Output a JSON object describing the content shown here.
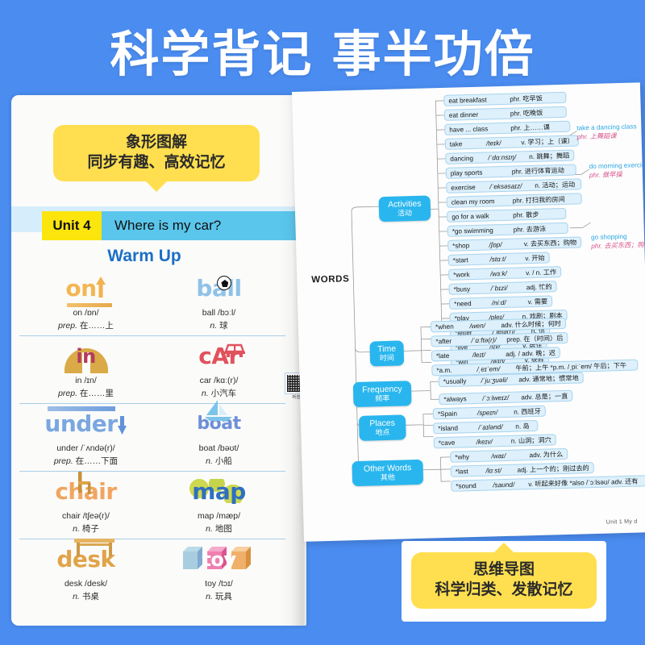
{
  "banner": {
    "title": "科学背记 事半功倍",
    "bg_color": "#4a8cf0",
    "text_color": "#ffffff"
  },
  "callout_top": {
    "line1": "象形图解",
    "line2": "同步有趣、高效记忆",
    "bg_color": "#ffdf4f"
  },
  "callout_bottom": {
    "line1": "思维导图",
    "line2": "科学归类、发散记忆",
    "bg_color": "#ffdf4f"
  },
  "left_page": {
    "unit_tag": "Unit 4",
    "unit_title": "Where is my car?",
    "section_title": "Warm Up",
    "qr": {
      "icon": "qr-code-icon",
      "label": "听音"
    },
    "column_left": [
      {
        "word": "on",
        "phonetic": "on /ɒn/",
        "pos": "prep.",
        "meaning": "在……上",
        "color": "#f4b651",
        "art": "arrow-up-icon"
      },
      {
        "word": "in",
        "phonetic": "in /ɪn/",
        "pos": "prep.",
        "meaning": "在……里",
        "color": "#b33a5e",
        "art": "dome-icon"
      },
      {
        "word": "under",
        "phonetic": "under /ˈʌndə(r)/",
        "pos": "prep.",
        "meaning": "在……下面",
        "color": "#7aa7e0",
        "art": "arrow-down-icon"
      },
      {
        "word": "chair",
        "phonetic": "chair /tʃeə(r)/",
        "pos": "n.",
        "meaning": "椅子",
        "color": "#f2a45f",
        "art": "chair-icon"
      },
      {
        "word": "desk",
        "phonetic": "desk /desk/",
        "pos": "n.",
        "meaning": "书桌",
        "color": "#e0a44a",
        "art": "desk-icon"
      }
    ],
    "column_right": [
      {
        "word": "ball",
        "phonetic": "ball /bɔːl/",
        "pos": "n.",
        "meaning": "球",
        "color": "#8fc2e8",
        "art": "soccer-ball-icon"
      },
      {
        "word": "cAr",
        "phonetic": "car /kɑː(r)/",
        "pos": "n.",
        "meaning": "小汽车",
        "color": "#e0525c",
        "art": "car-icon"
      },
      {
        "word": "boat",
        "phonetic": "boat /bəʊt/",
        "pos": "n.",
        "meaning": "小船",
        "color": "#6f8fd6",
        "art": "sailboat-icon"
      },
      {
        "word": "map",
        "phonetic": "map /mæp/",
        "pos": "n.",
        "meaning": "地图",
        "color": "#2f6fc0",
        "art": "map-blob-icon"
      },
      {
        "word": "toy",
        "phonetic": "toy /tɔɪ/",
        "pos": "n.",
        "meaning": "玩具",
        "color": "#ffffff",
        "art": "toy-blocks-icon"
      }
    ]
  },
  "right_page": {
    "root_label": "WORDS",
    "footer": "Unit 1   My d",
    "categories": [
      {
        "en": "Activities",
        "cn": "活动"
      },
      {
        "en": "Time",
        "cn": "时间"
      },
      {
        "en": "Frequency",
        "cn": "频率"
      },
      {
        "en": "Places",
        "cn": "地点"
      },
      {
        "en": "Other Words",
        "cn": "其他"
      }
    ],
    "activities": [
      {
        "word": "eat breakfast",
        "phon": "",
        "mean": "phr. 吃早饭"
      },
      {
        "word": "eat dinner",
        "phon": "",
        "mean": "phr. 吃晚饭"
      },
      {
        "word": "have ... class",
        "phon": "",
        "mean": "phr. 上……课"
      },
      {
        "word": "take",
        "phon": "/teɪk/",
        "mean": "v. 学习；上（课）"
      },
      {
        "word": "dancing",
        "phon": "/ˈdɑːnsɪŋ/",
        "mean": "n. 跳舞；舞蹈"
      },
      {
        "word": "play sports",
        "phon": "",
        "mean": "phr. 进行体育运动"
      },
      {
        "word": "exercise",
        "phon": "/ˈeksəsaɪz/",
        "mean": "n. 活动；运动"
      },
      {
        "word": "clean my room",
        "phon": "",
        "mean": "phr. 打扫我的房间"
      },
      {
        "word": "go for a walk",
        "phon": "",
        "mean": "phr. 散步"
      },
      {
        "word": "*go swimming",
        "phon": "",
        "mean": "phr. 去游泳"
      },
      {
        "word": "*shop",
        "phon": "/ʃɒp/",
        "mean": "v. 去买东西；购物"
      },
      {
        "word": "*start",
        "phon": "/stɑːt/",
        "mean": "v. 开始"
      },
      {
        "word": "*work",
        "phon": "/wɜːk/",
        "mean": "v. / n. 工作"
      },
      {
        "word": "*busy",
        "phon": "/ˈbɪzi/",
        "mean": "adj. 忙的"
      },
      {
        "word": "*need",
        "phon": "/niːd/",
        "mean": "v. 需要"
      },
      {
        "word": "*play",
        "phon": "/pleɪ/",
        "mean": "n. 戏剧；剧本"
      },
      {
        "word": "*letter",
        "phon": "/ˈletə(r)/",
        "mean": "n. 信"
      },
      {
        "word": "*live",
        "phon": "/lɪv/",
        "mean": "v. 居住"
      },
      {
        "word": "*win",
        "phon": "/wɪn/",
        "mean": "v. 获胜"
      }
    ],
    "time": [
      {
        "word": "*when",
        "phon": "/wen/",
        "mean": "adv. 什么时候；何时"
      },
      {
        "word": "*after",
        "phon": "/ˈɑːftə(r)/",
        "mean": "prep. 在（时间）后"
      },
      {
        "word": "*late",
        "phon": "/leɪt/",
        "mean": "adj. / adv. 晚；迟"
      },
      {
        "word": "*a.m.",
        "phon": "/ˌeɪˈem/",
        "mean": "午前；上午        *p.m.   /ˌpiːˈem/    午后；下午"
      }
    ],
    "frequency": [
      {
        "word": "*usually",
        "phon": "/ˈjuːʒuəli/",
        "mean": "adv. 通常地；惯常地"
      },
      {
        "word": "*always",
        "phon": "/ˈɔːlweɪz/",
        "mean": "adv. 总是；一直"
      }
    ],
    "places": [
      {
        "word": "*Spain",
        "phon": "/speɪn/",
        "mean": "n. 西班牙"
      },
      {
        "word": "*island",
        "phon": "/ˈaɪlənd/",
        "mean": "n. 岛"
      },
      {
        "word": "*cave",
        "phon": "/keɪv/",
        "mean": "n. 山洞；洞穴"
      }
    ],
    "other_words": [
      {
        "word": "*why",
        "phon": "/waɪ/",
        "mean": "adv. 为什么"
      },
      {
        "word": "*last",
        "phon": "/lɑːst/",
        "mean": "adj. 上一个的；刚过去的"
      },
      {
        "word": "*sound",
        "phon": "/saʊnd/",
        "mean": "v. 听起来好像        *also   /ˈɔːlsəʊ/   adv. 还有"
      }
    ],
    "annotations": [
      {
        "en": "take a dancing class",
        "cn": "phr. 上舞蹈课"
      },
      {
        "en": "do morning exercises",
        "cn": "phr. 做早操"
      },
      {
        "en": "go shopping",
        "cn": "phr. 去买东西；购物"
      }
    ]
  }
}
